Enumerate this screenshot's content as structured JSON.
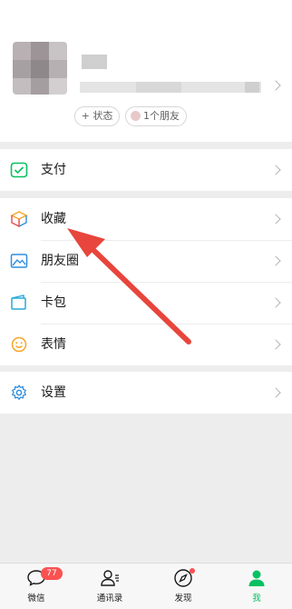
{
  "profile": {
    "status_label": "+ 状态",
    "friends_label": "1个朋友"
  },
  "menu": {
    "pay": "支付",
    "favorites": "收藏",
    "moments": "朋友圈",
    "cards": "卡包",
    "stickers": "表情",
    "settings": "设置"
  },
  "tabs": [
    {
      "label": "微信",
      "icon": "chat-icon",
      "badge": "77"
    },
    {
      "label": "通讯录",
      "icon": "contacts-icon"
    },
    {
      "label": "发现",
      "icon": "compass-icon",
      "dot": true
    },
    {
      "label": "我",
      "icon": "person-icon",
      "active": true
    }
  ],
  "colors": {
    "accent": "#07c160",
    "badge": "#fa5151",
    "annotation_arrow": "#e8453c"
  }
}
